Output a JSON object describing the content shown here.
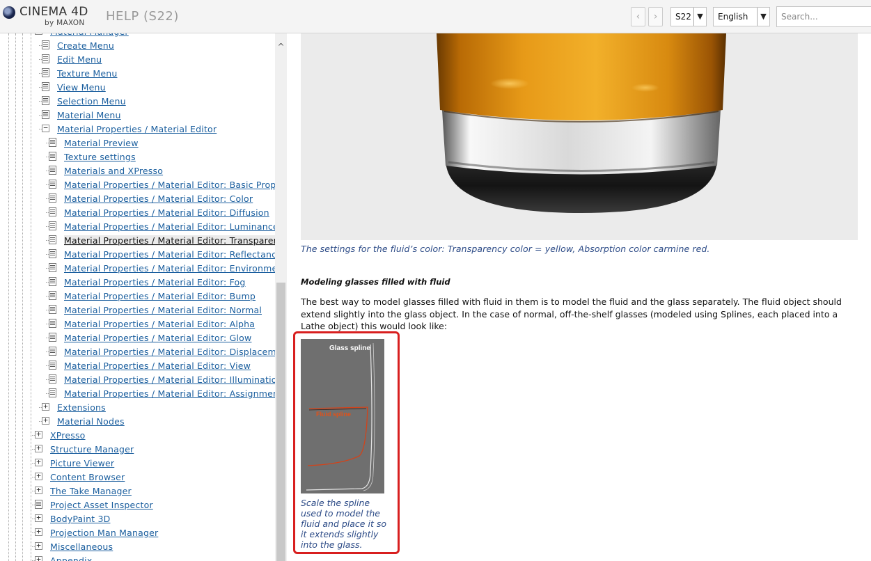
{
  "header": {
    "logo_main": "CINEMA 4D",
    "logo_sub": "by MAXON",
    "title": "HELP (S22)",
    "nav_back_icon": "‹",
    "nav_forward_icon": "›",
    "version_value": "S22",
    "language_value": "English",
    "search_placeholder": "Search..."
  },
  "sidebar": {
    "scroll_up_icon": "^",
    "items": [
      {
        "label": "Material Manager",
        "type": "expander-open",
        "level": 1
      },
      {
        "label": "Create Menu",
        "type": "doc",
        "level": 2
      },
      {
        "label": "Edit Menu",
        "type": "doc",
        "level": 2
      },
      {
        "label": "Texture Menu",
        "type": "doc",
        "level": 2
      },
      {
        "label": "View Menu",
        "type": "doc",
        "level": 2
      },
      {
        "label": "Selection Menu",
        "type": "doc",
        "level": 2
      },
      {
        "label": "Material Menu",
        "type": "doc",
        "level": 2
      },
      {
        "label": "Material Properties / Material Editor",
        "type": "expander-open",
        "level": 2
      },
      {
        "label": "Material Preview",
        "type": "doc",
        "level": 3
      },
      {
        "label": "Texture settings",
        "type": "doc",
        "level": 3
      },
      {
        "label": "Materials and XPresso",
        "type": "doc",
        "level": 3
      },
      {
        "label": "Material Properties / Material Editor: Basic Properties",
        "type": "doc",
        "level": 3
      },
      {
        "label": "Material Properties / Material Editor: Color",
        "type": "doc",
        "level": 3
      },
      {
        "label": "Material Properties / Material Editor: Diffusion",
        "type": "doc",
        "level": 3
      },
      {
        "label": "Material Properties / Material Editor: Luminance",
        "type": "doc",
        "level": 3
      },
      {
        "label": "Material Properties / Material Editor: Transparency",
        "type": "doc",
        "level": 3,
        "active": true
      },
      {
        "label": "Material Properties / Material Editor: Reflectance",
        "type": "doc",
        "level": 3
      },
      {
        "label": "Material Properties / Material Editor: Environment",
        "type": "doc",
        "level": 3
      },
      {
        "label": "Material Properties / Material Editor: Fog",
        "type": "doc",
        "level": 3
      },
      {
        "label": "Material Properties / Material Editor: Bump",
        "type": "doc",
        "level": 3
      },
      {
        "label": "Material Properties / Material Editor: Normal",
        "type": "doc",
        "level": 3
      },
      {
        "label": "Material Properties / Material Editor: Alpha",
        "type": "doc",
        "level": 3
      },
      {
        "label": "Material Properties / Material Editor: Glow",
        "type": "doc",
        "level": 3
      },
      {
        "label": "Material Properties / Material Editor: Displacement",
        "type": "doc",
        "level": 3
      },
      {
        "label": "Material Properties / Material Editor: View",
        "type": "doc",
        "level": 3
      },
      {
        "label": "Material Properties / Material Editor: Illumination",
        "type": "doc",
        "level": 3
      },
      {
        "label": "Material Properties / Material Editor: Assignment",
        "type": "doc",
        "level": 3
      },
      {
        "label": "Extensions",
        "type": "expander-closed",
        "level": 2
      },
      {
        "label": "Material Nodes",
        "type": "expander-closed",
        "level": 2
      },
      {
        "label": "XPresso",
        "type": "expander-closed",
        "level": 1
      },
      {
        "label": "Structure Manager",
        "type": "expander-closed",
        "level": 1
      },
      {
        "label": "Picture Viewer",
        "type": "expander-closed",
        "level": 1
      },
      {
        "label": "Content Browser",
        "type": "expander-closed",
        "level": 1
      },
      {
        "label": "The Take Manager",
        "type": "expander-closed",
        "level": 1
      },
      {
        "label": "Project Asset Inspector",
        "type": "doc",
        "level": 1
      },
      {
        "label": "BodyPaint 3D",
        "type": "expander-closed",
        "level": 1
      },
      {
        "label": "Projection Man Manager",
        "type": "expander-closed",
        "level": 1
      },
      {
        "label": "Miscellaneous",
        "type": "expander-closed",
        "level": 1
      },
      {
        "label": "Appendix",
        "type": "expander-closed",
        "level": 1
      }
    ]
  },
  "content": {
    "figure_caption": "The settings for the fluid’s color: Transparency color = yellow, Absorption color carmine red.",
    "section_heading": "Modeling glasses filled with fluid",
    "body_text": "The best way to model glasses filled with fluid in them is to model the fluid and the glass separately. The fluid object should extend slightly into the glass object. In the case of normal, off-the-shelf glasses (modeled using Splines, each placed into a Lathe object) this would look like:",
    "spline_image": {
      "glass_label": "Glass spline",
      "fluid_label": "Fluid spline"
    },
    "spline_caption": "Scale the spline used to model the fluid and place it so it extends slightly into the glass."
  },
  "colors": {
    "link": "#1a5e9e",
    "caption": "#2b4a86",
    "highlight_border": "#d81f1f",
    "fluid_spline": "#e0521a"
  }
}
